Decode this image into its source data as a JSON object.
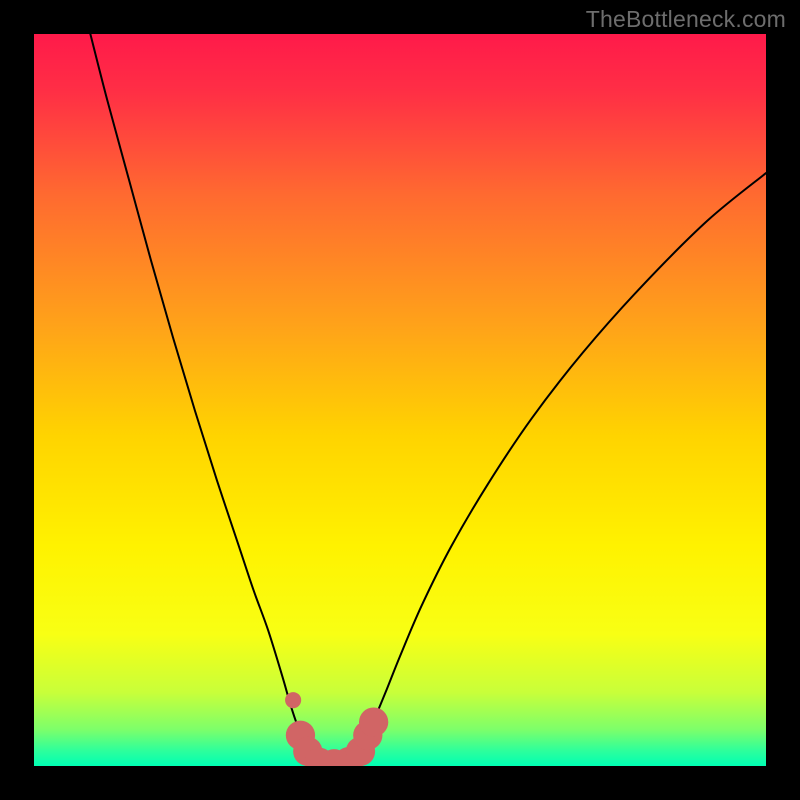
{
  "watermark": "TheBottleneck.com",
  "chart_data": {
    "type": "line",
    "title": "",
    "xlabel": "",
    "ylabel": "",
    "xlim": [
      0,
      100
    ],
    "ylim": [
      0,
      100
    ],
    "background_gradient": {
      "stops": [
        {
          "pos": 0.0,
          "color": "#ff1a4a"
        },
        {
          "pos": 0.08,
          "color": "#ff2f45"
        },
        {
          "pos": 0.22,
          "color": "#ff6a30"
        },
        {
          "pos": 0.4,
          "color": "#ffa319"
        },
        {
          "pos": 0.55,
          "color": "#ffd400"
        },
        {
          "pos": 0.7,
          "color": "#fff200"
        },
        {
          "pos": 0.82,
          "color": "#f8ff14"
        },
        {
          "pos": 0.9,
          "color": "#c8ff3a"
        },
        {
          "pos": 0.95,
          "color": "#7dff6a"
        },
        {
          "pos": 0.98,
          "color": "#2bff9d"
        },
        {
          "pos": 1.0,
          "color": "#00ffb3"
        }
      ]
    },
    "series": [
      {
        "name": "curve",
        "stroke": "#000000",
        "stroke_width": 2,
        "points": [
          {
            "x": 7.7,
            "y": 100.0
          },
          {
            "x": 10.0,
            "y": 91.0
          },
          {
            "x": 13.0,
            "y": 80.0
          },
          {
            "x": 16.0,
            "y": 69.0
          },
          {
            "x": 19.0,
            "y": 58.5
          },
          {
            "x": 22.0,
            "y": 48.5
          },
          {
            "x": 25.0,
            "y": 39.0
          },
          {
            "x": 28.0,
            "y": 30.0
          },
          {
            "x": 30.0,
            "y": 24.0
          },
          {
            "x": 32.0,
            "y": 18.5
          },
          {
            "x": 34.0,
            "y": 12.0
          },
          {
            "x": 35.0,
            "y": 8.5
          },
          {
            "x": 36.0,
            "y": 5.5
          },
          {
            "x": 37.0,
            "y": 3.2
          },
          {
            "x": 38.0,
            "y": 1.4
          },
          {
            "x": 39.0,
            "y": 0.4
          },
          {
            "x": 40.0,
            "y": 0.0
          },
          {
            "x": 41.0,
            "y": 0.0
          },
          {
            "x": 42.0,
            "y": 0.0
          },
          {
            "x": 43.0,
            "y": 0.4
          },
          {
            "x": 44.0,
            "y": 1.4
          },
          {
            "x": 45.0,
            "y": 3.0
          },
          {
            "x": 46.0,
            "y": 5.2
          },
          {
            "x": 48.0,
            "y": 10.0
          },
          {
            "x": 50.0,
            "y": 15.0
          },
          {
            "x": 53.0,
            "y": 22.0
          },
          {
            "x": 57.0,
            "y": 30.0
          },
          {
            "x": 62.0,
            "y": 38.5
          },
          {
            "x": 68.0,
            "y": 47.5
          },
          {
            "x": 75.0,
            "y": 56.5
          },
          {
            "x": 83.0,
            "y": 65.5
          },
          {
            "x": 92.0,
            "y": 74.5
          },
          {
            "x": 100.0,
            "y": 81.0
          }
        ]
      }
    ],
    "markers": [
      {
        "name": "accent-dot",
        "x": 35.4,
        "y": 9.0,
        "r": 1.1,
        "color": "#d16565"
      },
      {
        "name": "accent-blob-left-1",
        "x": 36.4,
        "y": 4.2,
        "r": 2.0,
        "color": "#d16565"
      },
      {
        "name": "accent-blob-left-2",
        "x": 37.4,
        "y": 2.0,
        "r": 2.0,
        "color": "#d16565"
      },
      {
        "name": "accent-blob-bottom-1",
        "x": 39.0,
        "y": 0.5,
        "r": 2.0,
        "color": "#d16565"
      },
      {
        "name": "accent-blob-bottom-2",
        "x": 41.0,
        "y": 0.3,
        "r": 2.0,
        "color": "#d16565"
      },
      {
        "name": "accent-blob-bottom-3",
        "x": 43.0,
        "y": 0.6,
        "r": 2.0,
        "color": "#d16565"
      },
      {
        "name": "accent-blob-right-1",
        "x": 44.6,
        "y": 2.0,
        "r": 2.0,
        "color": "#d16565"
      },
      {
        "name": "accent-blob-right-2",
        "x": 45.6,
        "y": 4.2,
        "r": 2.0,
        "color": "#d16565"
      },
      {
        "name": "accent-blob-right-3",
        "x": 46.4,
        "y": 6.0,
        "r": 2.0,
        "color": "#d16565"
      }
    ]
  }
}
